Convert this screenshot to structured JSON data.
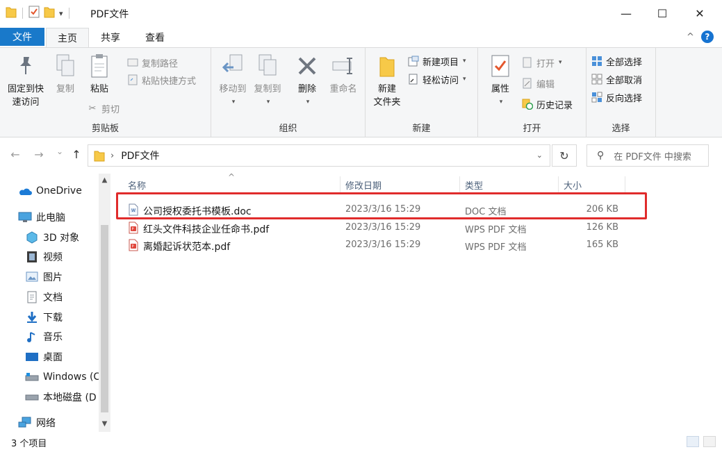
{
  "window": {
    "title": "PDF文件",
    "controls": {
      "minimize": "—",
      "maximize": "☐",
      "close": "✕"
    }
  },
  "quick_access": {
    "dropdown_glyph": "▾"
  },
  "ribbon_tabs": {
    "file": "文件",
    "home": "主页",
    "share": "共享",
    "view": "查看",
    "collapse_glyph": "^",
    "help_glyph": "?"
  },
  "ribbon": {
    "clipboard": {
      "group_label": "剪贴板",
      "pin": "固定到快\n速访问",
      "copy": "复制",
      "paste": "粘贴",
      "copy_path": "复制路径",
      "paste_shortcut": "粘贴快捷方式",
      "cut": "剪切"
    },
    "organize": {
      "group_label": "组织",
      "move_to": "移动到",
      "copy_to": "复制到",
      "delete": "删除",
      "rename": "重命名"
    },
    "new": {
      "group_label": "新建",
      "new_folder": "新建\n文件夹",
      "new_item": "新建项目",
      "easy_access": "轻松访问"
    },
    "open": {
      "group_label": "打开",
      "properties": "属性",
      "open": "打开",
      "edit": "编辑",
      "history": "历史记录"
    },
    "select": {
      "group_label": "选择",
      "select_all": "全部选择",
      "select_none": "全部取消",
      "invert": "反向选择"
    }
  },
  "address": {
    "back": "←",
    "forward": "→",
    "recent": "⌄",
    "up": "↑",
    "separator": "›",
    "path": "PDF文件",
    "dropdown": "⌄",
    "refresh": "↻",
    "search_placeholder": "在 PDF文件 中搜索",
    "search_glyph": "⚲"
  },
  "nav_pane": {
    "items": [
      {
        "label": "OneDrive",
        "icon": "cloud-icon"
      },
      {
        "label": "此电脑",
        "icon": "computer-icon"
      },
      {
        "label": "3D 对象",
        "icon": "cube-icon"
      },
      {
        "label": "视频",
        "icon": "film-icon"
      },
      {
        "label": "图片",
        "icon": "picture-icon"
      },
      {
        "label": "文档",
        "icon": "document-icon"
      },
      {
        "label": "下载",
        "icon": "download-icon"
      },
      {
        "label": "音乐",
        "icon": "music-icon"
      },
      {
        "label": "桌面",
        "icon": "desktop-icon"
      },
      {
        "label": "Windows (C",
        "icon": "drive-c-icon"
      },
      {
        "label": "本地磁盘 (D",
        "icon": "drive-d-icon"
      },
      {
        "label": "网络",
        "icon": "network-icon"
      }
    ],
    "scroll_up": "▲",
    "scroll_down": "▼"
  },
  "file_list": {
    "columns": {
      "name": "名称",
      "date": "修改日期",
      "type": "类型",
      "size": "大小"
    },
    "sort_glyph": "^",
    "rows": [
      {
        "name": "公司授权委托书模板.doc",
        "date": "2023/3/16 15:29",
        "type": "DOC 文档",
        "size": "206 KB",
        "icon": "word-doc-icon"
      },
      {
        "name": "红头文件科技企业任命书.pdf",
        "date": "2023/3/16 15:29",
        "type": "WPS PDF 文档",
        "size": "126 KB",
        "icon": "pdf-icon"
      },
      {
        "name": "离婚起诉状范本.pdf",
        "date": "2023/3/16 15:29",
        "type": "WPS PDF 文档",
        "size": "165 KB",
        "icon": "pdf-icon"
      }
    ],
    "highlight_color": "#e02b2b"
  },
  "status_bar": {
    "item_count": "3 个项目"
  },
  "colors": {
    "file_tab": "#1979ca",
    "ribbon_bg": "#f5f6f7",
    "highlight": "#e02b2b"
  }
}
